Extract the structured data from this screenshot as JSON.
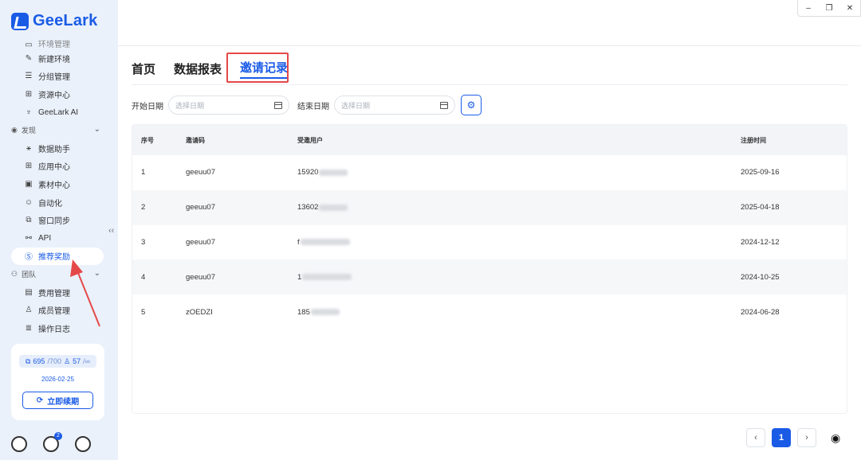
{
  "app": {
    "name": "GeeLark"
  },
  "sidebar": {
    "partial_item": "环境管理",
    "items_top": [
      {
        "label": "新建环境",
        "icon": "edit-icon"
      },
      {
        "label": "分组管理",
        "icon": "list-icon"
      },
      {
        "label": "资源中心",
        "icon": "resource-icon"
      },
      {
        "label": "GeeLark AI",
        "icon": "ai-icon"
      }
    ],
    "group_discover": "发现",
    "items_discover": [
      {
        "label": "数据助手",
        "icon": "chart-icon"
      },
      {
        "label": "应用中心",
        "icon": "grid-icon"
      },
      {
        "label": "素材中心",
        "icon": "media-icon"
      },
      {
        "label": "自动化",
        "icon": "robot-icon"
      },
      {
        "label": "窗口同步",
        "icon": "sync-icon"
      },
      {
        "label": "API",
        "icon": "api-icon"
      },
      {
        "label": "推荐奖励",
        "icon": "dollar-icon"
      }
    ],
    "group_team": "团队",
    "items_team": [
      {
        "label": "费用管理",
        "icon": "wallet-icon"
      },
      {
        "label": "成员管理",
        "icon": "user-icon"
      },
      {
        "label": "操作日志",
        "icon": "log-icon"
      }
    ],
    "collapse_glyph": "‹‹",
    "card": {
      "quota_used": "695",
      "quota_total": "/700",
      "members": "57",
      "members_total": "/∞",
      "date": "2026-02-25",
      "renew_label": "立即续期"
    },
    "notification_count": "2"
  },
  "window": {
    "minimize": "–",
    "restore": "❐",
    "close": "✕"
  },
  "tabs": [
    "首页",
    "数据报表",
    "邀请记录"
  ],
  "active_tab": 2,
  "filters": {
    "start_label": "开始日期",
    "start_placeholder": "选择日期",
    "end_label": "结束日期",
    "end_placeholder": "选择日期"
  },
  "table": {
    "headers": [
      "序号",
      "邀请码",
      "受邀用户",
      "注册时间"
    ],
    "rows": [
      {
        "index": "1",
        "code": "geeuu07",
        "user": "15920",
        "date": "2025-09-16"
      },
      {
        "index": "2",
        "code": "geeuu07",
        "user": "13602",
        "date": "2025-04-18"
      },
      {
        "index": "3",
        "code": "geeuu07",
        "user": "f",
        "date": "2024-12-12"
      },
      {
        "index": "4",
        "code": "geeuu07",
        "user": "1",
        "date": "2024-10-25"
      },
      {
        "index": "5",
        "code": "zOEDZI",
        "user": "185",
        "date": "2024-06-28"
      }
    ]
  },
  "pagination": {
    "prev": "‹",
    "current": "1",
    "next": "›"
  },
  "colors": {
    "accent": "#1a5be6",
    "annotation": "#e54848"
  }
}
